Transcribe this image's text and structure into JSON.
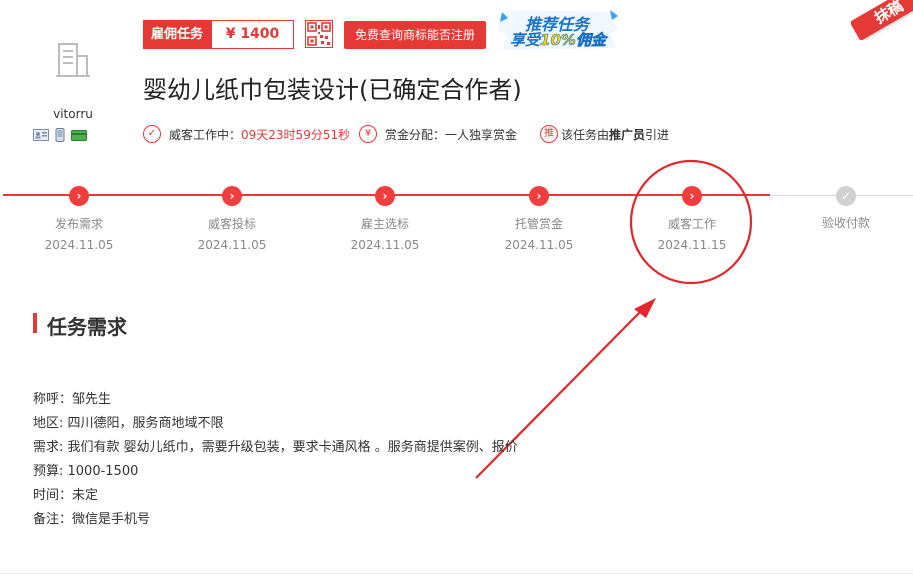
{
  "ribbon_text": "抹稿",
  "user": {
    "name": "vitorru"
  },
  "header": {
    "task_type": "雇佣任务",
    "price": "¥ 1400",
    "trademark_button": "免费查询商标能否注册",
    "promo_line1": "推荐任务",
    "promo_line2_prefix": "享受",
    "promo_line2_highlight": "10%佣金"
  },
  "title": "婴幼儿纸巾包装设计(已确定合作者)",
  "info": {
    "status_label": "威客工作中：",
    "countdown": "09天23时59分51秒",
    "reward_icon": "¥",
    "reward_label": "赏金分配：一人独享赏金",
    "promo_icon": "推",
    "promo_prefix": "该任务由",
    "promo_bold": "推广员",
    "promo_suffix": "引进"
  },
  "steps": [
    {
      "label": "发布需求",
      "date": "2024.11.05",
      "done": true
    },
    {
      "label": "威客投标",
      "date": "2024.11.05",
      "done": true
    },
    {
      "label": "雇主选标",
      "date": "2024.11.05",
      "done": true
    },
    {
      "label": "托管赏金",
      "date": "2024.11.05",
      "done": true
    },
    {
      "label": "威客工作",
      "date": "2024.11.15",
      "done": true
    },
    {
      "label": "验收付款",
      "date": "",
      "done": false
    }
  ],
  "requirements": {
    "title": "任务需求",
    "lines": [
      "称呼：邹先生",
      "地区: 四川德阳，服务商地域不限",
      "需求: 我们有款 婴幼儿纸巾，需要升级包装，要求卡通风格 。服务商提供案例、报价",
      "预算: 1000-1500",
      "时间：未定",
      "备注：微信是手机号"
    ]
  },
  "colors": {
    "accent": "#e53935",
    "promo_blue": "#1a6fc0",
    "promo_gold": "#ffd600",
    "muted": "#888888"
  }
}
